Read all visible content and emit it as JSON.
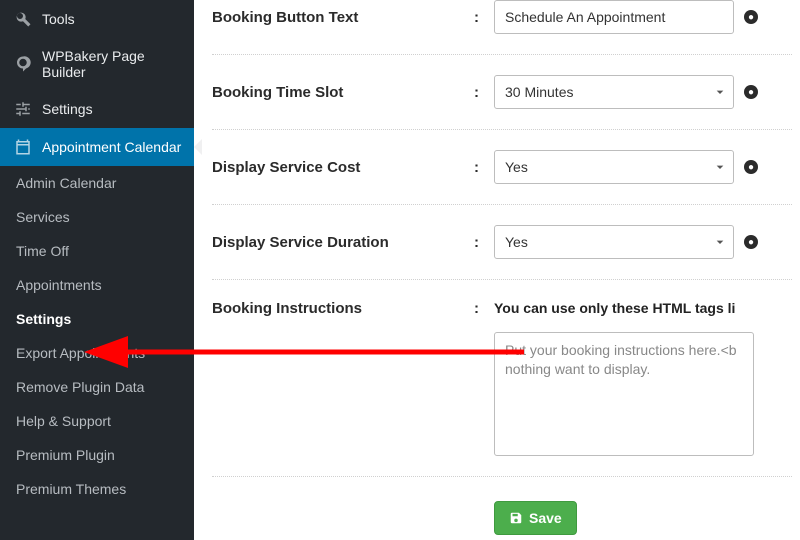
{
  "sidebar": {
    "top": [
      {
        "label": "Tools",
        "icon": "wrench-icon"
      },
      {
        "label": "WPBakery Page Builder",
        "icon": "wpb-icon"
      },
      {
        "label": "Settings",
        "icon": "sliders-icon"
      }
    ],
    "active": {
      "label": "Appointment Calendar",
      "icon": "calendar-icon"
    },
    "sub": [
      {
        "label": "Admin Calendar"
      },
      {
        "label": "Services"
      },
      {
        "label": "Time Off"
      },
      {
        "label": "Appointments"
      },
      {
        "label": "Settings"
      },
      {
        "label": "Export Appointments"
      },
      {
        "label": "Remove Plugin Data"
      },
      {
        "label": "Help & Support"
      },
      {
        "label": "Premium Plugin"
      },
      {
        "label": "Premium Themes"
      }
    ],
    "sub_current_index": 4
  },
  "form": {
    "rows": {
      "button_text": {
        "label": "Booking Button Text",
        "value": "Schedule An Appointment"
      },
      "time_slot": {
        "label": "Booking Time Slot",
        "value": "30 Minutes"
      },
      "display_cost": {
        "label": "Display Service Cost",
        "value": "Yes"
      },
      "display_duration": {
        "label": "Display Service Duration",
        "value": "Yes"
      },
      "instructions": {
        "label": "Booking Instructions",
        "hint": "You can use only these HTML tags li",
        "textarea": "Put your booking instructions here.<b nothing want to display."
      }
    },
    "save_label": "Save"
  },
  "colon": ":"
}
